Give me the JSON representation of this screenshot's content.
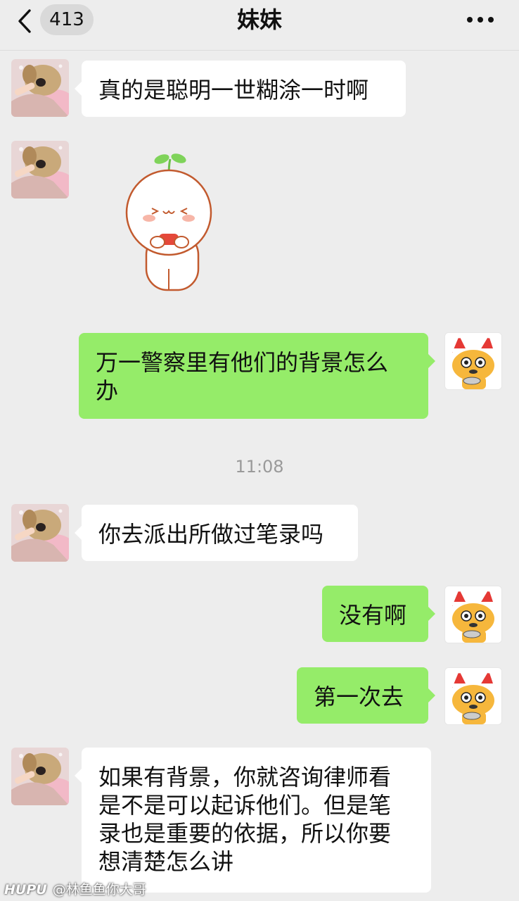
{
  "header": {
    "unread_count": "413",
    "title": "妹妹"
  },
  "messages": [
    {
      "side": "in",
      "type": "text",
      "text": "真的是聪明一世糊涂一时啊"
    },
    {
      "side": "in",
      "type": "sticker",
      "sticker": "sprout-bun-sticker"
    },
    {
      "side": "out",
      "type": "text",
      "lines": [
        "万一警察里有他们的背景怎么",
        "办"
      ]
    },
    {
      "type": "timestamp",
      "text": "11:08"
    },
    {
      "side": "in",
      "type": "text",
      "text": "你去派出所做过笔录吗"
    },
    {
      "side": "out",
      "type": "text",
      "text": "没有啊"
    },
    {
      "side": "out",
      "type": "text",
      "text": "第一次去"
    },
    {
      "side": "in",
      "type": "text",
      "lines": [
        "如果有背景，你就咨询律师看",
        "是不是可以起诉他们。但是笔",
        "录也是重要的依据，所以你要",
        "想清楚怎么讲"
      ]
    }
  ],
  "watermark": {
    "brand": "HUPU",
    "user": "@林鱼鱼你大哥"
  },
  "colors": {
    "background": "#ededed",
    "incoming_bubble": "#ffffff",
    "outgoing_bubble": "#95ec69"
  },
  "icons": {
    "back": "chevron-left-icon",
    "more": "more-dots-icon"
  }
}
